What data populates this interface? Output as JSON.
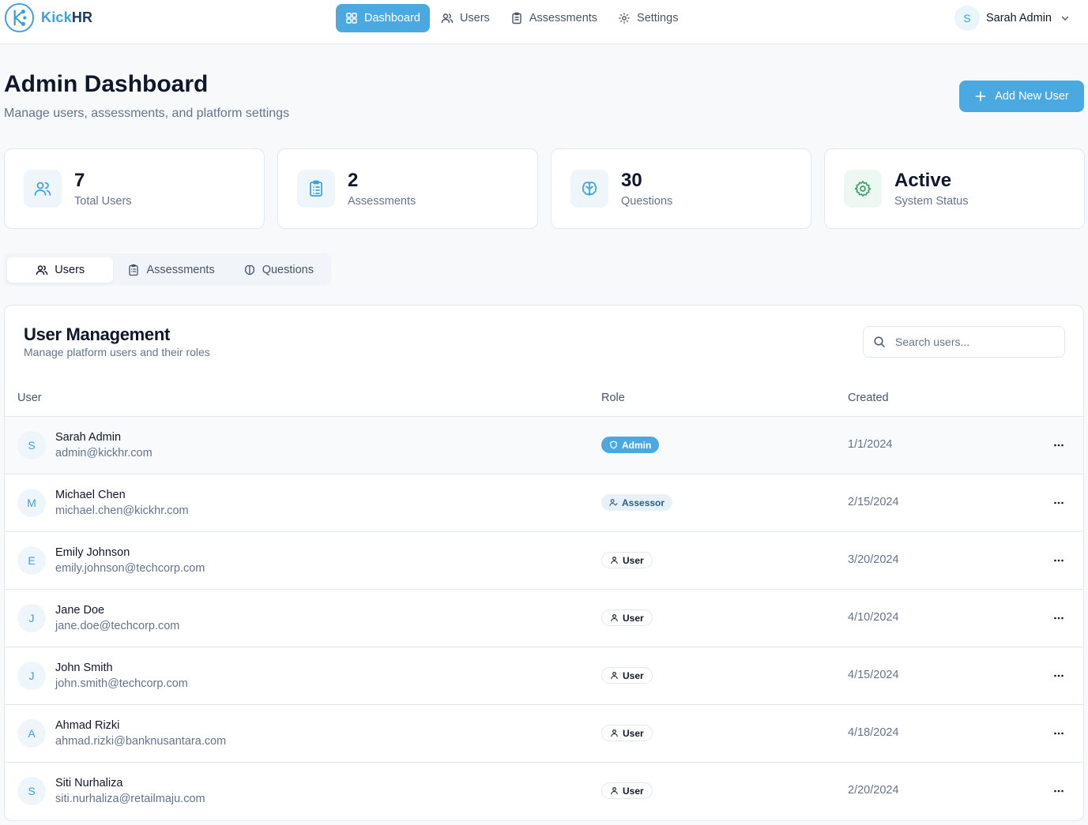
{
  "brand": {
    "name_part1": "Kick",
    "name_part2": "HR",
    "logo_icon": "kickhr-logo-icon"
  },
  "nav": {
    "items": [
      {
        "label": "Dashboard",
        "icon": "grid-icon",
        "active": true
      },
      {
        "label": "Users",
        "icon": "users-icon",
        "active": false
      },
      {
        "label": "Assessments",
        "icon": "clipboard-icon",
        "active": false
      },
      {
        "label": "Settings",
        "icon": "gear-icon",
        "active": false
      }
    ]
  },
  "user_menu": {
    "initial": "S",
    "name": "Sarah Admin"
  },
  "header": {
    "title": "Admin Dashboard",
    "subtitle": "Manage users, assessments, and platform settings",
    "add_button": "Add New User"
  },
  "stats": [
    {
      "value": "7",
      "label": "Total Users",
      "icon": "users-icon"
    },
    {
      "value": "2",
      "label": "Assessments",
      "icon": "clipboard-list-icon"
    },
    {
      "value": "30",
      "label": "Questions",
      "icon": "brain-icon"
    },
    {
      "value": "Active",
      "label": "System Status",
      "icon": "gear-icon"
    }
  ],
  "tabs": [
    {
      "label": "Users",
      "active": true
    },
    {
      "label": "Assessments",
      "active": false
    },
    {
      "label": "Questions",
      "active": false
    }
  ],
  "panel": {
    "title": "User Management",
    "subtitle": "Manage platform users and their roles",
    "search_placeholder": "Search users...",
    "columns": {
      "user": "User",
      "role": "Role",
      "created": "Created"
    }
  },
  "users": [
    {
      "initial": "S",
      "name": "Sarah Admin",
      "email": "admin@kickhr.com",
      "role": "Admin",
      "created": "1/1/2024"
    },
    {
      "initial": "M",
      "name": "Michael Chen",
      "email": "michael.chen@kickhr.com",
      "role": "Assessor",
      "created": "2/15/2024"
    },
    {
      "initial": "E",
      "name": "Emily Johnson",
      "email": "emily.johnson@techcorp.com",
      "role": "User",
      "created": "3/20/2024"
    },
    {
      "initial": "J",
      "name": "Jane Doe",
      "email": "jane.doe@techcorp.com",
      "role": "User",
      "created": "4/10/2024"
    },
    {
      "initial": "J",
      "name": "John Smith",
      "email": "john.smith@techcorp.com",
      "role": "User",
      "created": "4/15/2024"
    },
    {
      "initial": "A",
      "name": "Ahmad Rizki",
      "email": "ahmad.rizki@banknusantara.com",
      "role": "User",
      "created": "4/18/2024"
    },
    {
      "initial": "S",
      "name": "Siti Nurhaliza",
      "email": "siti.nurhaliza@retailmaju.com",
      "role": "User",
      "created": "2/20/2024"
    }
  ],
  "colors": {
    "accent": "#4aa9e0",
    "brand_dark": "#1e3a5f",
    "success": "#3aa26b"
  }
}
